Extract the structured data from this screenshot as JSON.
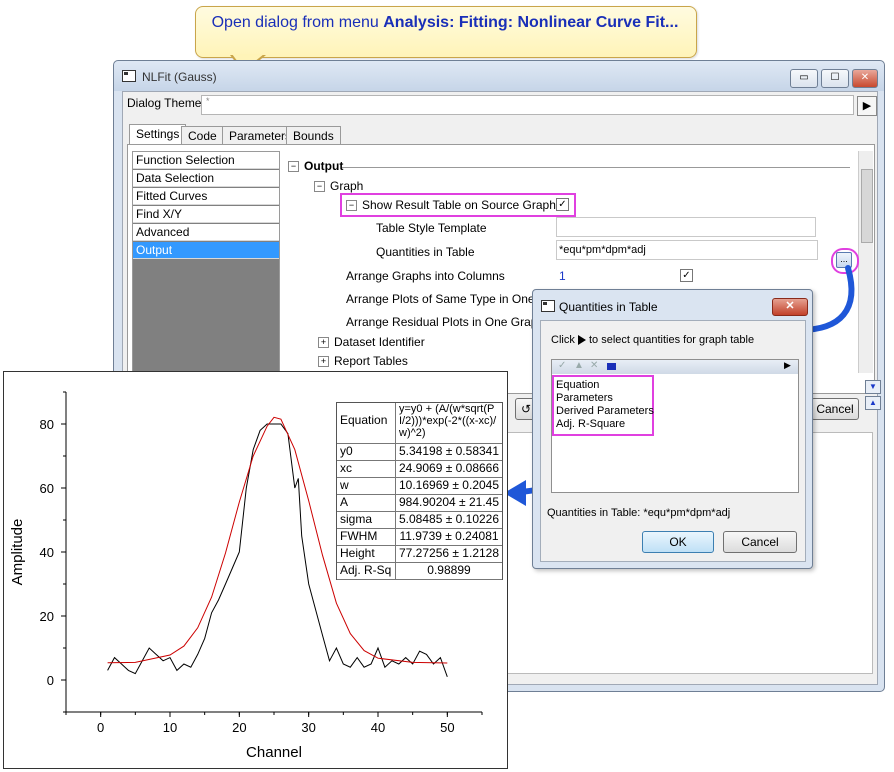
{
  "callout": {
    "prefix": "Open dialog from menu ",
    "bold": "Analysis: Fitting: Nonlinear Curve Fit..."
  },
  "window": {
    "title": "NLFit (Gauss)",
    "dialog_theme_label": "Dialog Theme",
    "dialog_theme_value": "*",
    "tabs": [
      "Settings",
      "Code",
      "Parameters",
      "Bounds"
    ],
    "nav_items": [
      "Function Selection",
      "Data Selection",
      "Fitted Curves",
      "Find X/Y",
      "Advanced",
      "Output"
    ],
    "tree": {
      "output": "Output",
      "graph": "Graph",
      "show_result": "Show Result Table on Source Graph",
      "table_style": "Table Style Template",
      "quantities_label": "Quantities in Table",
      "quantities_value": "*equ*pm*dpm*adj",
      "arrange_cols": "Arrange Graphs into Columns",
      "arrange_cols_value": "1",
      "arrange_plots": "Arrange Plots of Same Type in One Gr",
      "arrange_resid": "Arrange Residual Plots in One Graph",
      "dataset_id": "Dataset Identifier",
      "report_tables": "Report Tables"
    },
    "cancel_label": "Cancel",
    "dots_label": "..."
  },
  "dialog": {
    "title": "Quantities in Table",
    "instruction_pre": "Click",
    "instruction_post": "to select quantities for graph table",
    "items": [
      "Equation",
      "Parameters",
      "Derived Parameters",
      "Adj. R-Square"
    ],
    "status": "Quantities in Table: *equ*pm*dpm*adj",
    "ok": "OK",
    "cancel": "Cancel"
  },
  "colors": {
    "highlight": "#e040e0",
    "arrow": "#1f57d8",
    "fit_curve": "#cc0000",
    "data_curve": "#000000"
  },
  "result_table": {
    "rows": [
      {
        "k": "Equation",
        "v": "y=y0 + (A/(w*sqrt(PI/2)))*exp(-2*((x-xc)/w)^2)"
      },
      {
        "k": "y0",
        "v": "5.34198 ± 0.58341"
      },
      {
        "k": "xc",
        "v": "24.9069 ± 0.08666"
      },
      {
        "k": "w",
        "v": "10.16969 ± 0.2045"
      },
      {
        "k": "A",
        "v": "984.90204 ± 21.45"
      },
      {
        "k": "sigma",
        "v": "5.08485 ± 0.10226"
      },
      {
        "k": "FWHM",
        "v": "11.9739 ± 0.24081"
      },
      {
        "k": "Height",
        "v": "77.27256 ± 1.2128"
      },
      {
        "k": "Adj. R-Sq",
        "v": "0.98899"
      }
    ]
  },
  "chart_data": {
    "type": "line",
    "xlabel": "Channel",
    "ylabel": "Amplitude",
    "xlim": [
      -5,
      55
    ],
    "ylim": [
      -10,
      90
    ],
    "xticks": [
      0,
      10,
      20,
      30,
      40,
      50
    ],
    "yticks": [
      0,
      20,
      40,
      60,
      80
    ],
    "series": [
      {
        "x": [
          1,
          2,
          3,
          4,
          5,
          6,
          7,
          8,
          9,
          10,
          11,
          12,
          13,
          14,
          15,
          16,
          17,
          18,
          19,
          20,
          21,
          22,
          23,
          24,
          25,
          26,
          27,
          28,
          28.5,
          29,
          30,
          31,
          32,
          33,
          34,
          35,
          36,
          37,
          38,
          39,
          40,
          41,
          42,
          43,
          44,
          45,
          46,
          47,
          48,
          49,
          50
        ],
        "y": [
          3,
          7,
          5,
          3,
          2,
          6,
          10,
          8,
          6,
          7,
          3,
          5,
          4,
          8,
          13,
          21,
          25,
          30,
          35,
          40,
          60,
          72,
          78,
          80,
          80,
          80,
          77,
          60,
          63,
          45,
          30,
          22,
          14,
          6,
          10,
          5,
          4,
          7,
          4,
          5,
          10,
          4,
          6,
          5,
          7,
          5,
          9,
          8,
          5,
          7,
          1
        ]
      },
      {
        "x": [
          1,
          5,
          10,
          12,
          14,
          16,
          18,
          20,
          22,
          24,
          25,
          26,
          28,
          30,
          32,
          34,
          36,
          38,
          40,
          45,
          50
        ],
        "y": [
          5.4,
          5.5,
          7.8,
          10.6,
          16.3,
          25.9,
          39.7,
          55.6,
          70.0,
          79.3,
          82.1,
          81.5,
          72.0,
          56.0,
          39.0,
          24.0,
          14.5,
          9.2,
          6.8,
          5.5,
          5.3
        ]
      }
    ]
  }
}
